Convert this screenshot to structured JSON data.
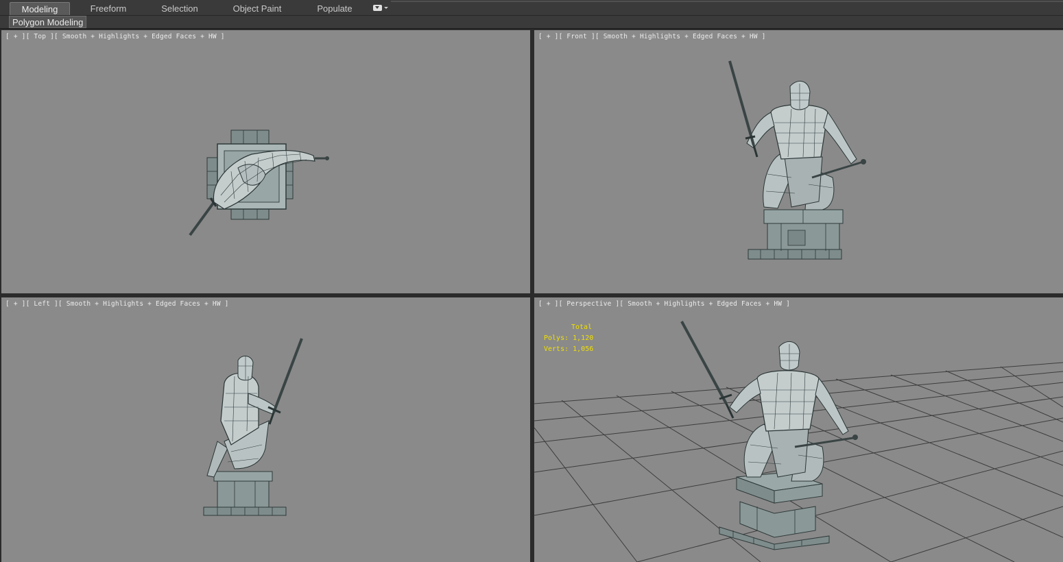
{
  "ribbon": {
    "tabs": [
      {
        "label": "Modeling",
        "active": true
      },
      {
        "label": "Freeform",
        "active": false
      },
      {
        "label": "Selection",
        "active": false
      },
      {
        "label": "Object Paint",
        "active": false
      },
      {
        "label": "Populate",
        "active": false
      }
    ],
    "dropdown_icon": "ribbon-options-icon"
  },
  "subpanel": {
    "label": "Polygon Modeling"
  },
  "viewports": {
    "top": {
      "label": "[ + ][ Top ][ Smooth + Highlights + Edged Faces + HW ]"
    },
    "front": {
      "label": "[ + ][ Front ][ Smooth + Highlights + Edged Faces + HW ]"
    },
    "left": {
      "label": "[ + ][ Left ][ Smooth + Highlights + Edged Faces + HW ]"
    },
    "perspective": {
      "label": "[ + ][ Perspective ][ Smooth + Highlights + Edged Faces + HW ]"
    }
  },
  "stats": {
    "title": "Total",
    "polys": "Polys: 1,120",
    "verts": "Verts: 1,056",
    "color": "#f0e000"
  },
  "colors": {
    "viewport_bg": "#8a8a8a",
    "ui_bg": "#3a3a3a",
    "model_light": "#c8d0d0",
    "model_dark": "#5a6666"
  }
}
